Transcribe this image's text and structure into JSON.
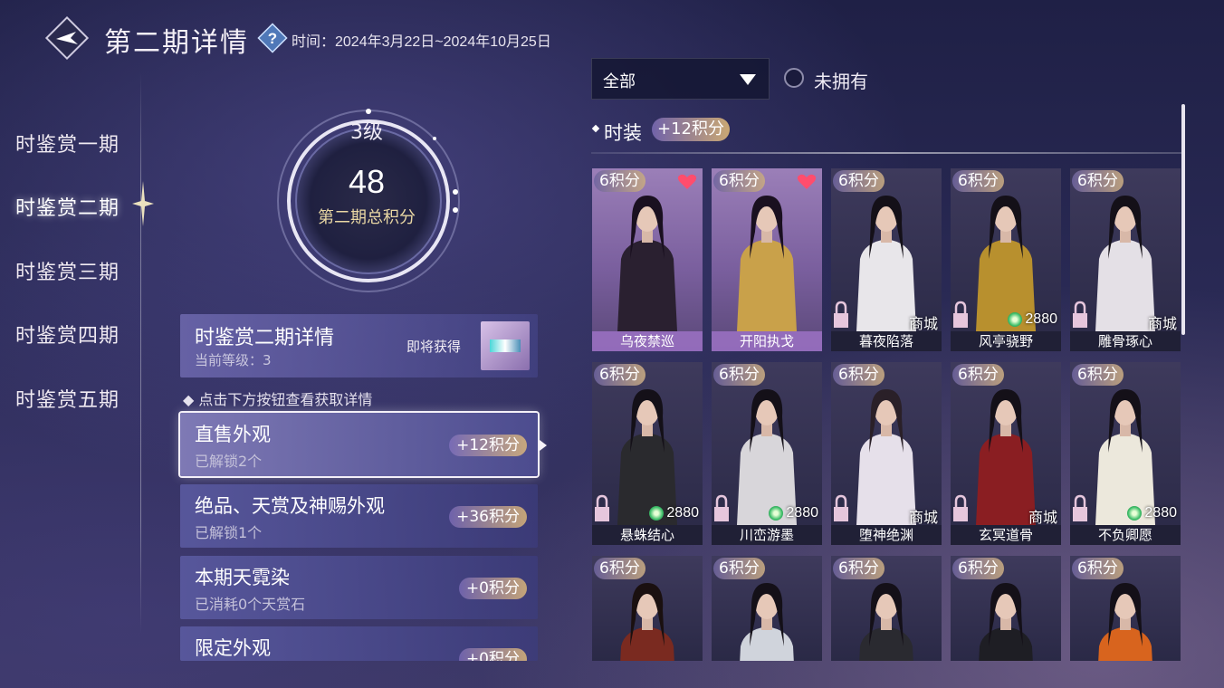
{
  "header": {
    "title": "第二期详情",
    "time_text": "时间：2024年3月22日~2024年10月25日"
  },
  "nav": {
    "items": [
      {
        "label": "时鉴赏一期"
      },
      {
        "label": "时鉴赏二期"
      },
      {
        "label": "时鉴赏三期"
      },
      {
        "label": "时鉴赏四期"
      },
      {
        "label": "时鉴赏五期"
      }
    ],
    "active_index": 1
  },
  "score": {
    "level": "3级",
    "value": "48",
    "label": "第二期总积分"
  },
  "detail": {
    "title": "时鉴赏二期详情",
    "current_level": "当前等级：3",
    "soon_label": "即将获得"
  },
  "hint": "点击下方按钮查看获取详情",
  "categories": [
    {
      "title": "直售外观",
      "sub": "已解锁2个",
      "points": "+12积分"
    },
    {
      "title": "绝品、天赏及神赐外观",
      "sub": "已解锁1个",
      "points": "+36积分"
    },
    {
      "title": "本期天霓染",
      "sub": "已消耗0个天赏石",
      "points": "+0积分"
    },
    {
      "title": "限定外观",
      "sub": "",
      "points": "+0积分"
    }
  ],
  "filter": {
    "value": "全部",
    "unowned_label": "未拥有"
  },
  "section": {
    "title": "时装",
    "points": "+12积分"
  },
  "colors": {
    "accent_gold": "#e9d7a4",
    "owned_purple": "#9b7fb8",
    "heart_red": "#ff4d6d",
    "jade_green": "#3fbf6a"
  },
  "items": [
    {
      "badge": "6积分",
      "name": "乌夜禁巡",
      "owned": true,
      "price": "",
      "currency": "",
      "hair": "#1a1020",
      "outfit": "#2a2030"
    },
    {
      "badge": "6积分",
      "name": "开阳执戈",
      "owned": true,
      "price": "",
      "currency": "",
      "hair": "#1a1020",
      "outfit": "#c9a14a"
    },
    {
      "badge": "6积分",
      "name": "暮夜陷落",
      "owned": false,
      "price": "商城",
      "currency": "mall",
      "hair": "#141018",
      "outfit": "#e8e6ea"
    },
    {
      "badge": "6积分",
      "name": "风亭骁野",
      "owned": false,
      "price": "2880",
      "currency": "jade",
      "hair": "#141018",
      "outfit": "#b8902e"
    },
    {
      "badge": "6积分",
      "name": "雕骨琢心",
      "owned": false,
      "price": "商城",
      "currency": "mall",
      "hair": "#141018",
      "outfit": "#e4e0e6"
    },
    {
      "badge": "6积分",
      "name": "悬蛛结心",
      "owned": false,
      "price": "2880",
      "currency": "jade",
      "hair": "#141018",
      "outfit": "#2a2a2e"
    },
    {
      "badge": "6积分",
      "name": "川峦游墨",
      "owned": false,
      "price": "2880",
      "currency": "jade",
      "hair": "#141018",
      "outfit": "#d8d6da"
    },
    {
      "badge": "6积分",
      "name": "堕神绝渊",
      "owned": false,
      "price": "商城",
      "currency": "mall",
      "hair": "#2a2028",
      "outfit": "#e6e0ea"
    },
    {
      "badge": "6积分",
      "name": "玄冥道骨",
      "owned": false,
      "price": "商城",
      "currency": "mall",
      "hair": "#141018",
      "outfit": "#8a1e22"
    },
    {
      "badge": "6积分",
      "name": "不负卿愿",
      "owned": false,
      "price": "2880",
      "currency": "jade",
      "hair": "#141018",
      "outfit": "#ece8dc"
    },
    {
      "badge": "6积分",
      "name": "",
      "owned": false,
      "price": "",
      "currency": "",
      "hair": "#1a1010",
      "outfit": "#7a2a20"
    },
    {
      "badge": "6积分",
      "name": "",
      "owned": false,
      "price": "",
      "currency": "",
      "hair": "#141018",
      "outfit": "#d0d4dc"
    },
    {
      "badge": "6积分",
      "name": "",
      "owned": false,
      "price": "",
      "currency": "",
      "hair": "#141018",
      "outfit": "#2a2a30"
    },
    {
      "badge": "6积分",
      "name": "",
      "owned": false,
      "price": "",
      "currency": "",
      "hair": "#141018",
      "outfit": "#1e1e24"
    },
    {
      "badge": "6积分",
      "name": "",
      "owned": false,
      "price": "",
      "currency": "",
      "hair": "#141018",
      "outfit": "#d8641e"
    }
  ]
}
